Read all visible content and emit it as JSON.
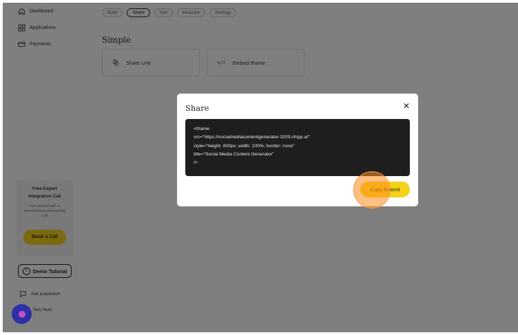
{
  "sidebar": {
    "items": [
      {
        "label": "Dashboard",
        "icon": "home-icon"
      },
      {
        "label": "Applications",
        "icon": "grid-icon"
      },
      {
        "label": "Payments",
        "icon": "card-icon"
      }
    ],
    "promo": {
      "title_line1": "Free Expert",
      "title_line2": "Integration Call",
      "text": "Get started with a personalized onboarding call",
      "button": "Book a Call"
    },
    "demo_button": "Demo Tutorial",
    "ask_question": "Ask a question",
    "user_name": "Serj Hunt"
  },
  "tabs": [
    "Build",
    "Share",
    "Sell",
    "Measure",
    "Settings"
  ],
  "active_tab": "Share",
  "main": {
    "section_title": "Simple",
    "cards": [
      {
        "label": "Share Link",
        "icon": "link-icon"
      },
      {
        "label": "Embed Iframe",
        "icon": "code-icon"
      }
    ]
  },
  "modal": {
    "title": "Share",
    "close_symbol": "✕",
    "code_lines": [
      "<iframe",
      "src=\"https://socialmediacontentgenerator-3203.chipp.ai\"",
      "style=\"height: 800px; width: 100%; border: none\"",
      "title=\"Social Media Content Generator\"",
      "/>"
    ],
    "copy_button": "Copy Embed"
  },
  "colors": {
    "accent_yellow": "#f5d21a",
    "overlay": "rgba(0,0,0,0.5)",
    "code_bg": "#1e1e1e",
    "chat_bubble": "#2f2fa8"
  }
}
